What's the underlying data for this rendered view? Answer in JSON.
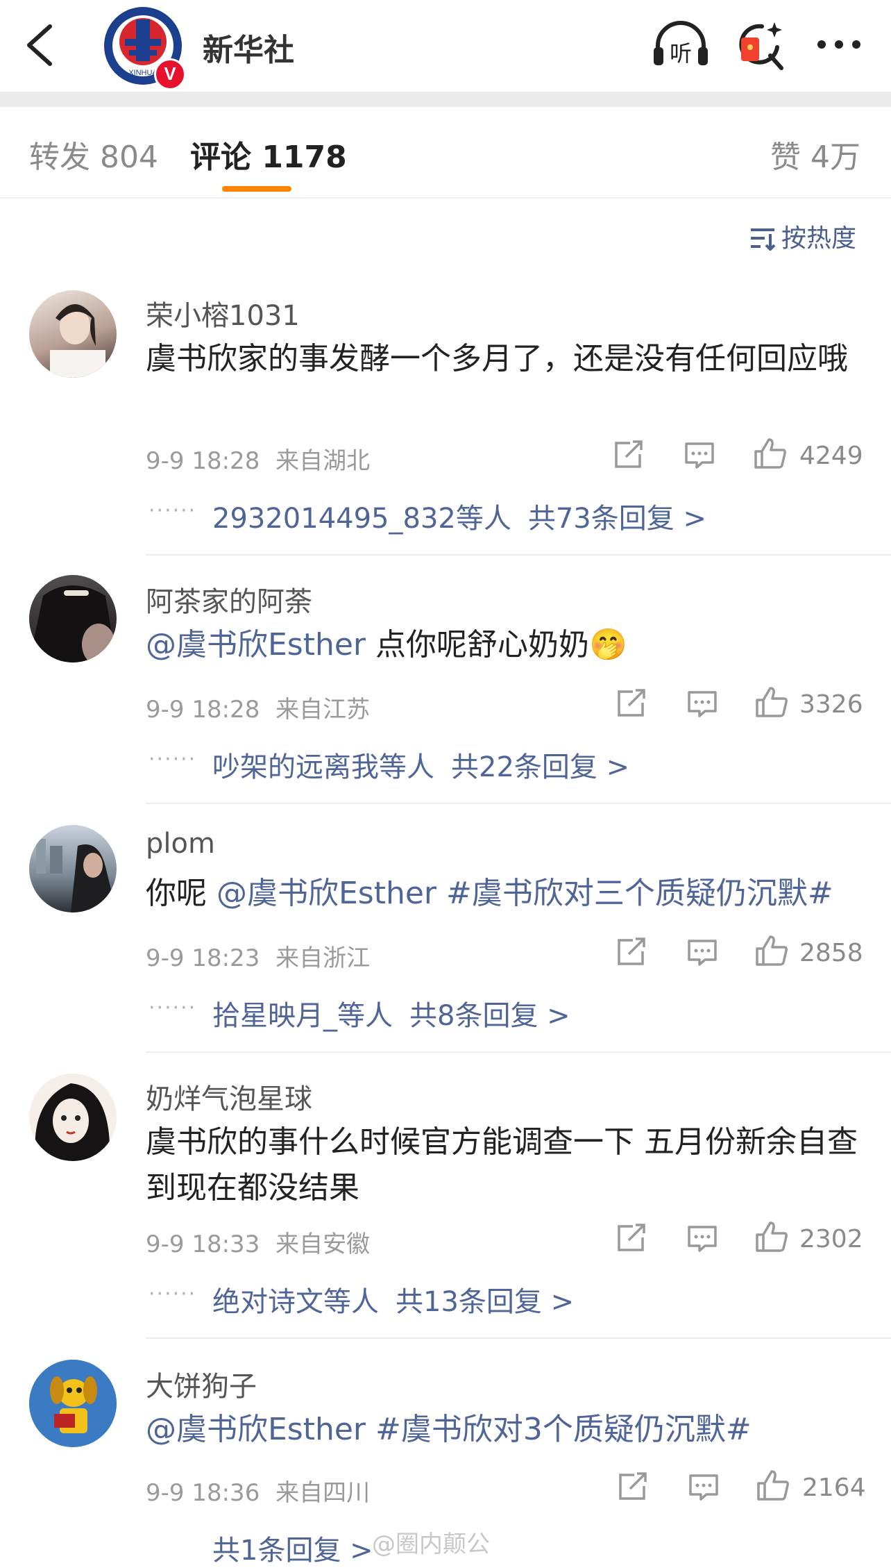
{
  "header": {
    "account_name": "新华社",
    "logo_text": "XINHUA",
    "verified_badge": "V",
    "icons": [
      "back-icon",
      "listen-icon",
      "red-packet-search-icon",
      "more-icon"
    ],
    "listen_label": "听"
  },
  "tabs": [
    {
      "label": "转发 804",
      "active": false
    },
    {
      "label": "评论 1178",
      "active": true
    },
    {
      "label": "赞 4万",
      "active": false
    }
  ],
  "sort_label": "按热度",
  "comments": [
    {
      "user": "荣小榕1031",
      "text_plain": "虞书欣家的事发酵一个多月了，还是没有任何回应哦",
      "time": "9-9 18:28",
      "location": "来自湖北",
      "likes": "4249",
      "reply_users": "2932014495_832等人",
      "reply_count": "共73条回复 >",
      "avatar_color": "#c9b9ad"
    },
    {
      "user": "阿茶家的阿荼",
      "mention": "@虞书欣Esther",
      "text_plain": " 点你呢舒心奶奶",
      "emoji": "🤭",
      "time": "9-9 18:28",
      "location": "来自江苏",
      "likes": "3326",
      "reply_users": "吵架的远离我等人",
      "reply_count": "共22条回复 >",
      "avatar_color": "#2d2a2c"
    },
    {
      "user": "plom",
      "text_plain": "你呢 ",
      "mention": "@虞书欣Esther",
      "hashtag": "#虞书欣对三个质疑仍沉默#",
      "time": "9-9 18:23",
      "location": "来自浙江",
      "likes": "2858",
      "reply_users": "拾星映月_等人",
      "reply_count": "共8条回复 >",
      "avatar_color": "#7f8c99"
    },
    {
      "user": "奶烊气泡星球",
      "text_plain": "虞书欣的事什么时候官方能调查一下 五月份新余自查到现在都没结果",
      "time": "9-9 18:33",
      "location": "来自安徽",
      "likes": "2302",
      "reply_users": "绝对诗文等人",
      "reply_count": "共13条回复 >",
      "avatar_color": "#f3eee9"
    },
    {
      "user": "大饼狗子",
      "mention": "@虞书欣Esther",
      "hashtag": "#虞书欣对3个质疑仍沉默#",
      "time": "9-9 18:36",
      "location": "来自四川",
      "likes": "2164",
      "reply_count": "共1条回复 >",
      "avatar_color": "#2f6fb8"
    }
  ],
  "watermark": "@圈内颠公"
}
